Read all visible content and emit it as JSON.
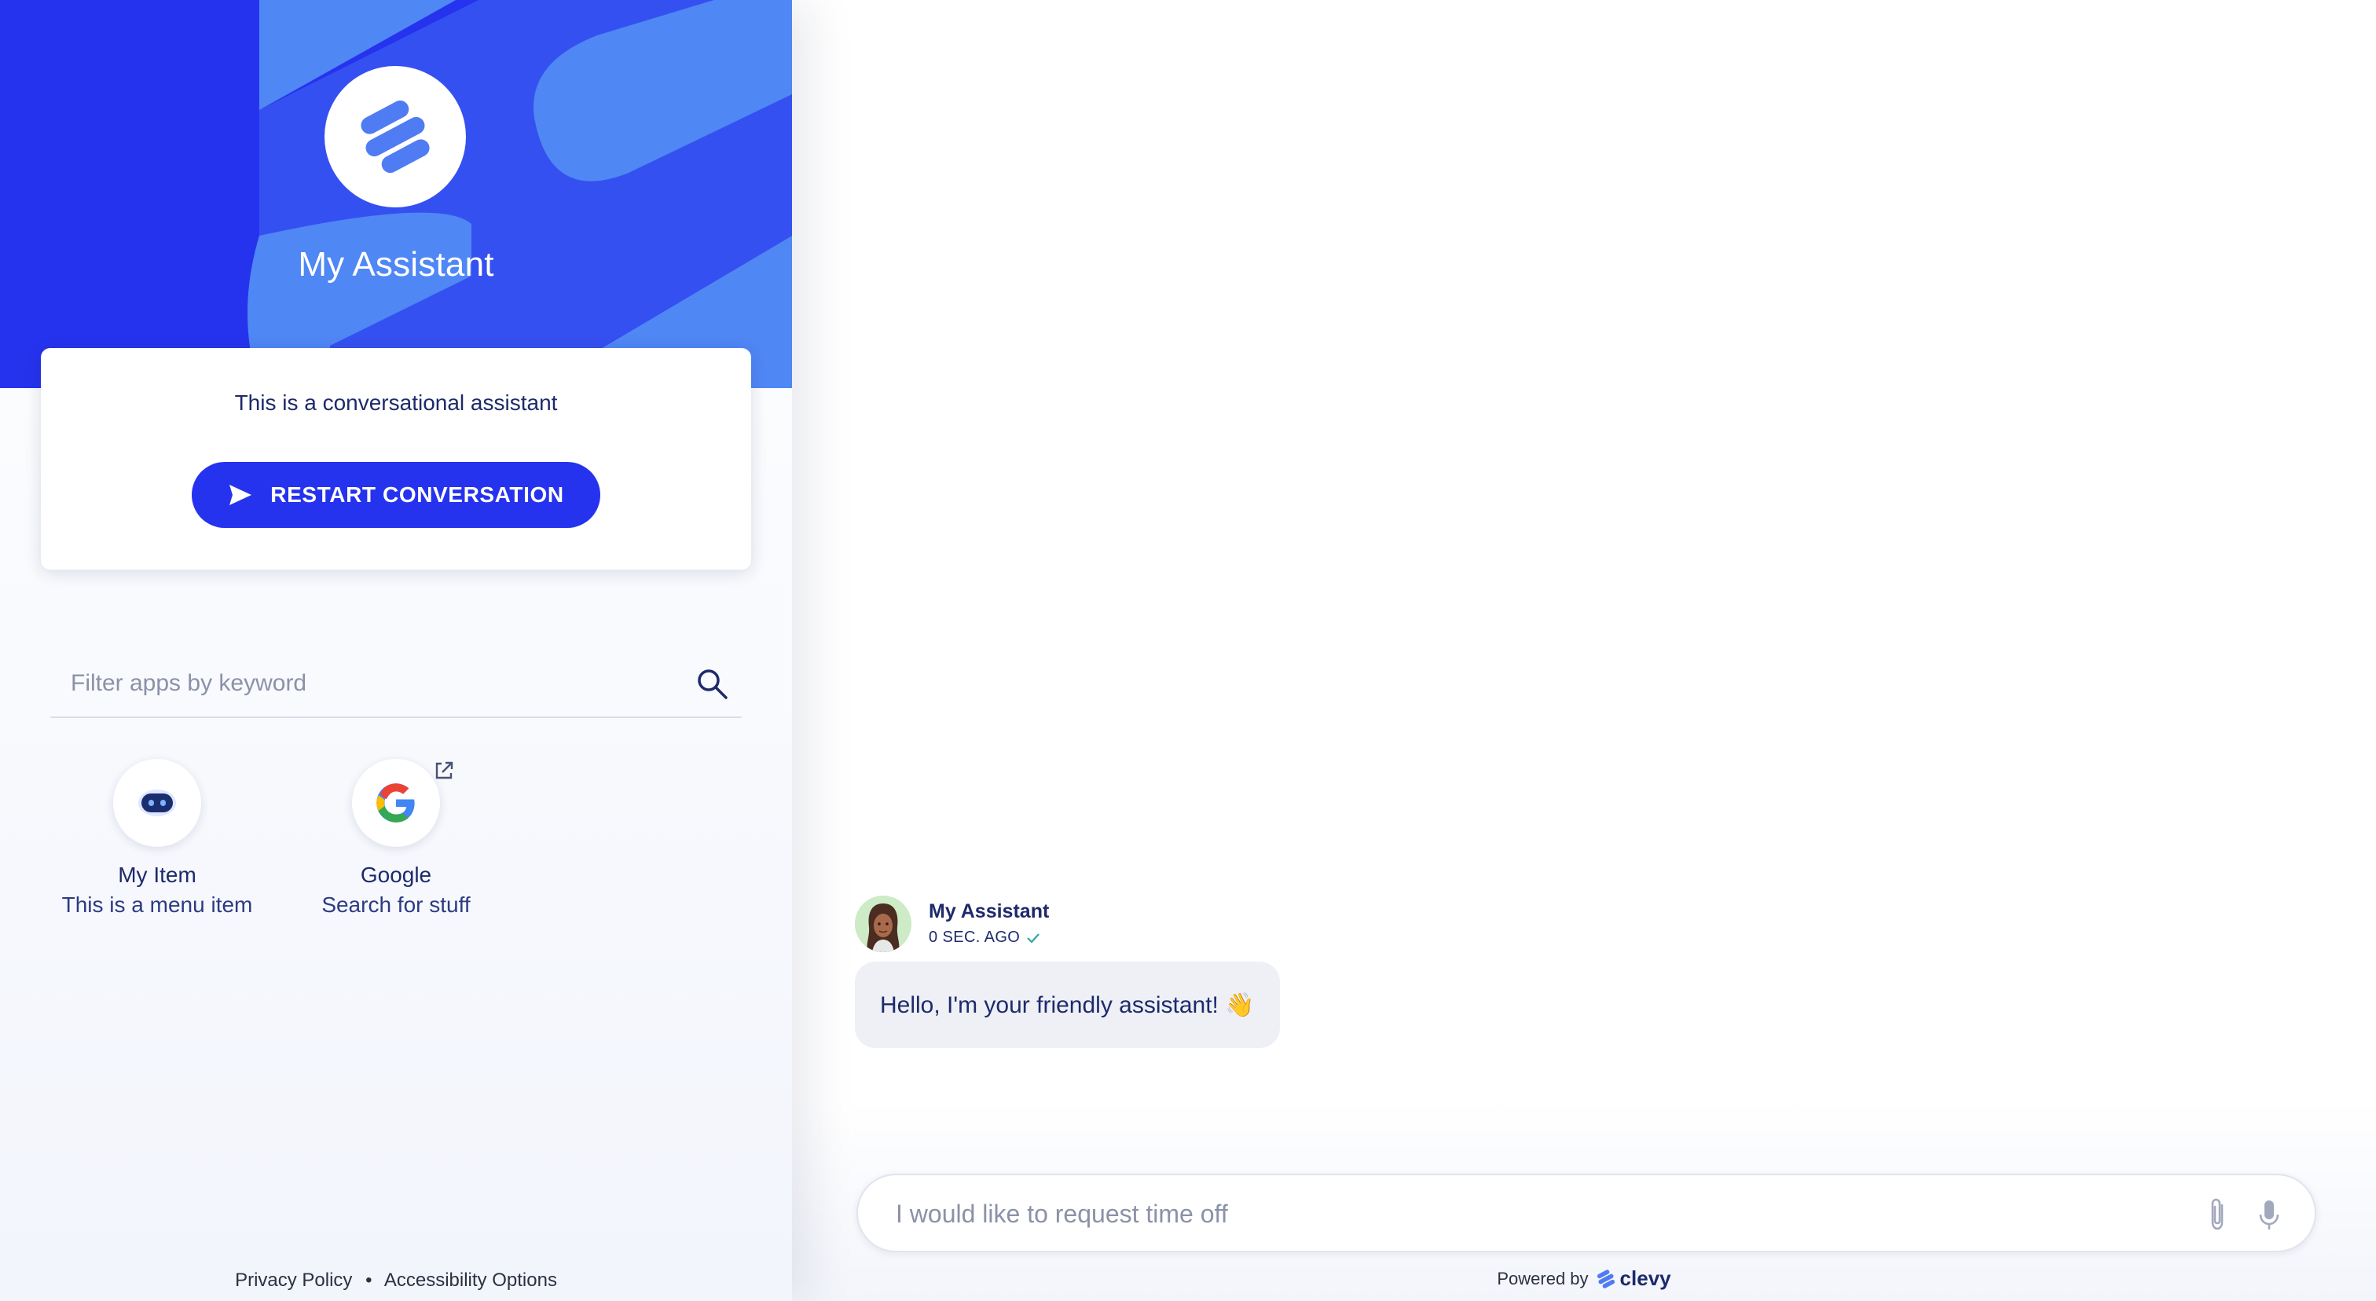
{
  "colors": {
    "accent": "#2633EE",
    "hero_shape_light": "#4F87F5",
    "hero_shape_mid": "#3550F0",
    "text_dark": "#1D2A6B",
    "bubble_bg": "#EEF0F6",
    "avatar_bg": "#CDEBC6",
    "check": "#2FA7A0"
  },
  "sidebar": {
    "assistant_name": "My Assistant",
    "intro": {
      "text": "This is a conversational assistant",
      "restart_label": "RESTART CONVERSATION",
      "restart_icon": "send-icon"
    },
    "filter": {
      "placeholder": "Filter apps by keyword",
      "value": "",
      "icon": "search-icon"
    },
    "apps": [
      {
        "name": "My Item",
        "description": "This is a menu item",
        "icon": "robot-icon",
        "external": false
      },
      {
        "name": "Google",
        "description": "Search for stuff",
        "icon": "google-icon",
        "external": true
      }
    ],
    "footer": {
      "privacy": "Privacy Policy",
      "separator": "•",
      "accessibility": "Accessibility Options"
    }
  },
  "chat": {
    "messages": [
      {
        "sender": "My Assistant",
        "time": "0 SEC. AGO",
        "status_icon": "check-icon",
        "text": "Hello, I'm your friendly assistant! 👋"
      }
    ],
    "composer": {
      "placeholder": "I would like to request time off",
      "value": "",
      "attach_icon": "paperclip-icon",
      "mic_icon": "microphone-icon"
    },
    "powered_by": {
      "label": "Powered by",
      "brand": "clevy"
    }
  }
}
